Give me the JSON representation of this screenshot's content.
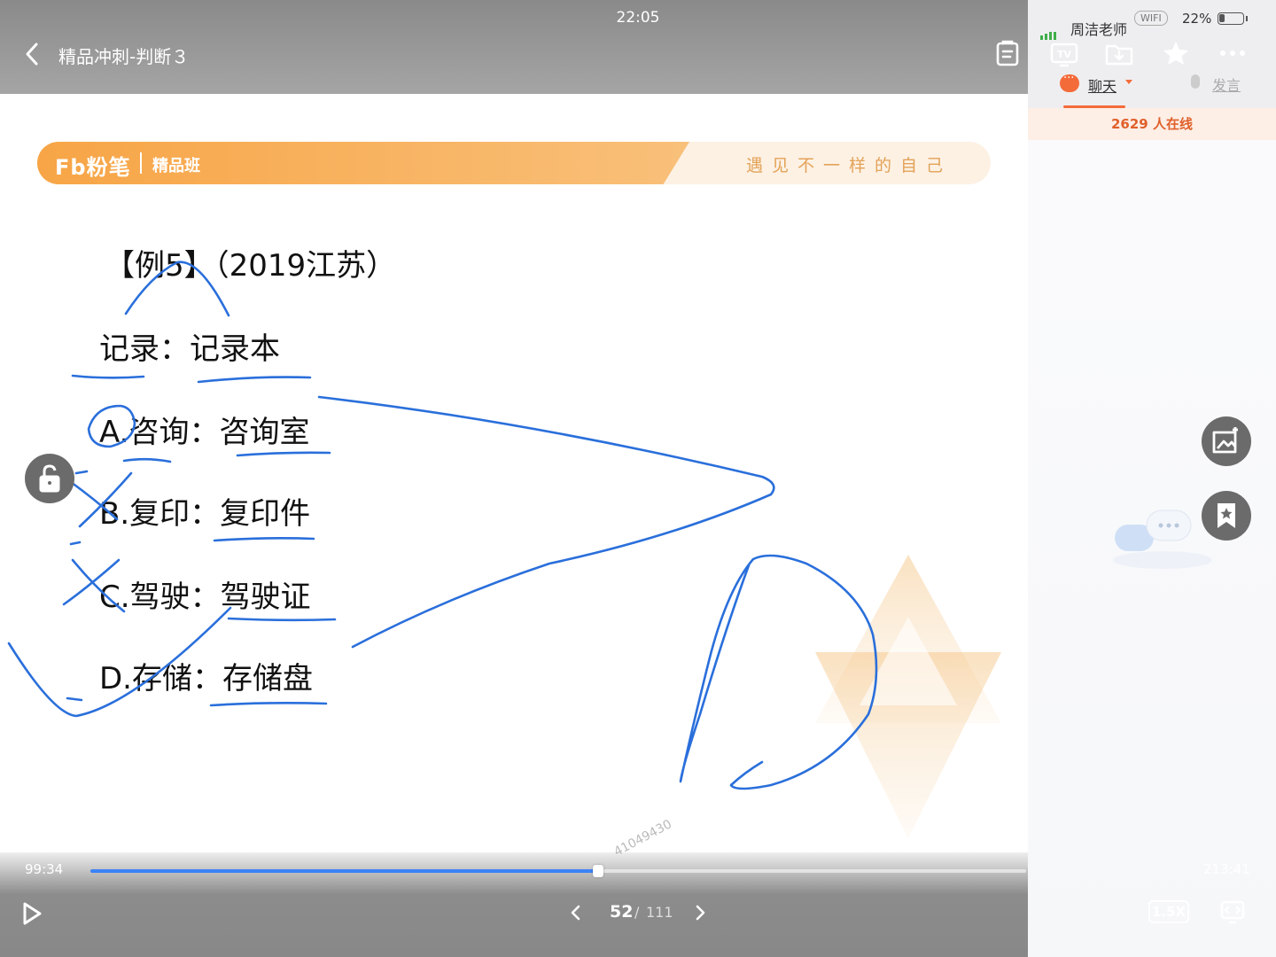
{
  "status": {
    "time": "22:05",
    "carrier": "周洁老师",
    "wifi": "WIFI",
    "battery": "22%"
  },
  "header": {
    "title": "精品冲刺-判断３",
    "icons": [
      "back-chevron-icon",
      "notes-icon"
    ]
  },
  "right_panel": {
    "icons": [
      "tv-icon",
      "download-icon",
      "star-icon",
      "more-icon"
    ],
    "tabs": {
      "chat": "聊天",
      "speak": "发言"
    },
    "online_count": "2629 人在线"
  },
  "float_buttons": [
    "image-capture-icon",
    "bookmark-icon"
  ],
  "slide": {
    "banner": {
      "brand": "Fb粉笔",
      "class": "精品班",
      "slogan": "遇见不一样的自己"
    },
    "question": {
      "title": "【例5】（2019江苏）",
      "stem": "记录：记录本",
      "options": [
        "A.咨询：咨询室",
        "B.复印：复印件",
        "C.驾驶：驾驶证",
        "D.存储：存储盘"
      ]
    },
    "watermark": "41049430"
  },
  "player": {
    "current_time": "99:34",
    "total_time": "213:41",
    "progress": 0.543,
    "page_current": "52",
    "page_sep": "/",
    "page_total": "111",
    "speed": "1.5X"
  },
  "colors": {
    "accent": "#f46b3a",
    "progress": "#3b82f6",
    "ink": "#2a6fdb",
    "banner": "#f7a546"
  }
}
